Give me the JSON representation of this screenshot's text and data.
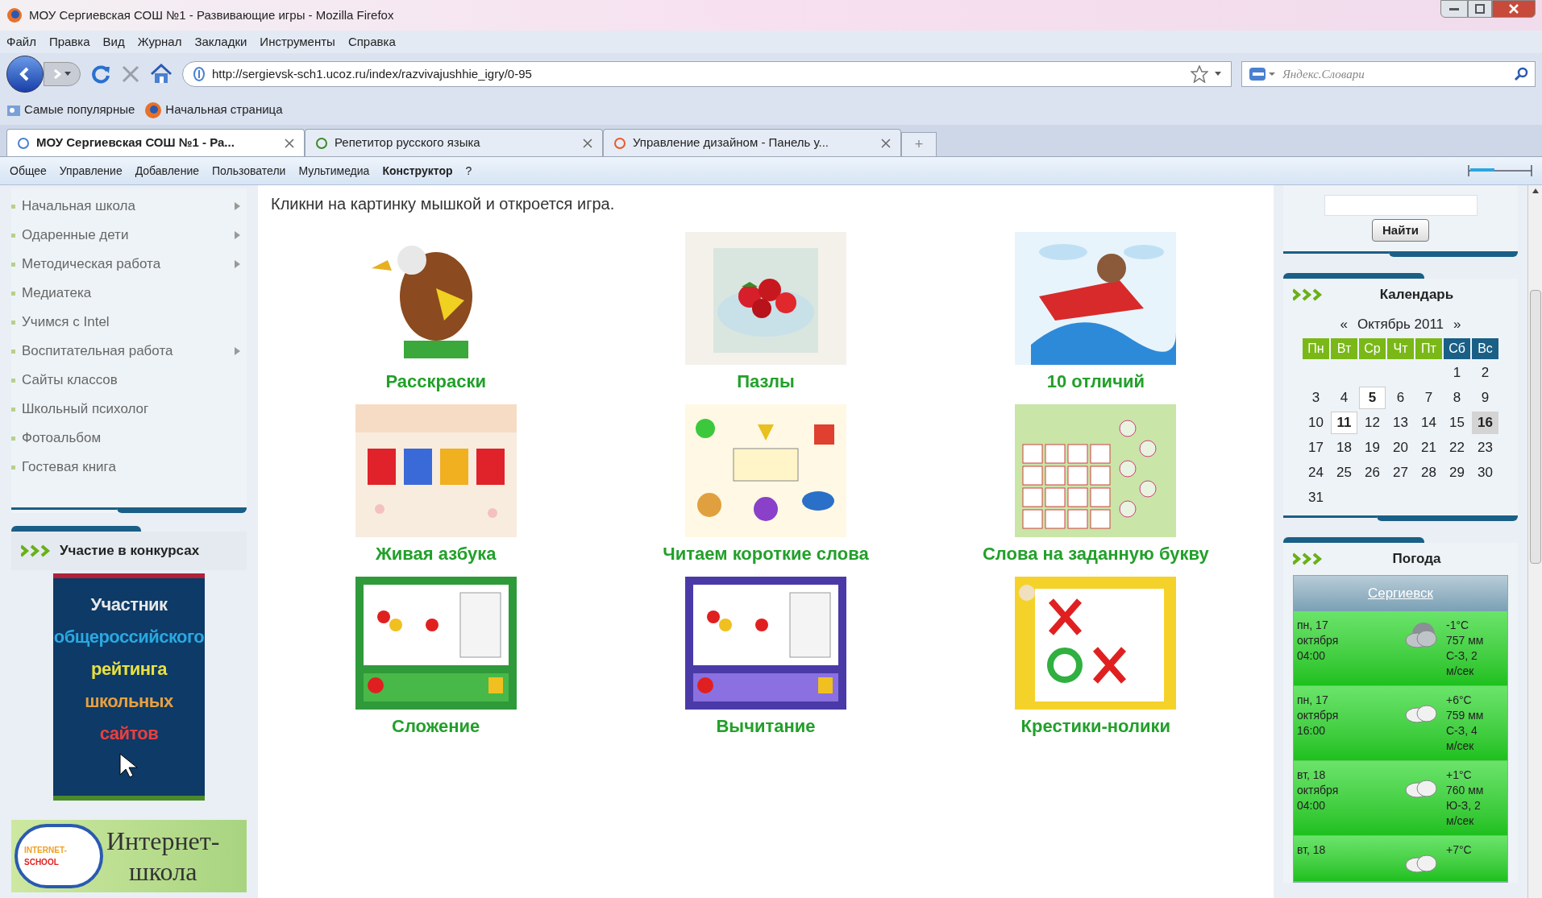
{
  "window": {
    "title": "МОУ Сергиевская СОШ №1 - Развивающие игры - Mozilla Firefox"
  },
  "menu": [
    "Файл",
    "Правка",
    "Вид",
    "Журнал",
    "Закладки",
    "Инструменты",
    "Справка"
  ],
  "address": {
    "value": "http://sergievsk-sch1.ucoz.ru/index/razvivajushhie_igry/0-95"
  },
  "search": {
    "placeholder": "Яндекс.Словари"
  },
  "bookmarks": [
    "Самые популярные",
    "Начальная страница"
  ],
  "tabs": [
    {
      "label": "МОУ Сергиевская СОШ №1 - Ра...",
      "selected": true
    },
    {
      "label": "Репетитор русского языка",
      "selected": false
    },
    {
      "label": "Управление дизайном - Панель у...",
      "selected": false
    }
  ],
  "new_tab": "+",
  "ucoz_panel": [
    {
      "label": "Общее",
      "selected": false
    },
    {
      "label": "Управление",
      "selected": false
    },
    {
      "label": "Добавление",
      "selected": false
    },
    {
      "label": "Пользователи",
      "selected": false
    },
    {
      "label": "Мультимедиа",
      "selected": false
    },
    {
      "label": "Конструктор",
      "selected": true
    },
    {
      "label": "?",
      "selected": false
    }
  ],
  "sidebar": {
    "items": [
      {
        "label": "Начальная школа",
        "has_submenu": true
      },
      {
        "label": "Одаренные дети",
        "has_submenu": true
      },
      {
        "label": "Методическая работа",
        "has_submenu": true
      },
      {
        "label": "Медиатека",
        "has_submenu": false
      },
      {
        "label": "Учимся с Intel",
        "has_submenu": false
      },
      {
        "label": "Воспитательная работа",
        "has_submenu": true
      },
      {
        "label": "Сайты классов",
        "has_submenu": false
      },
      {
        "label": "Школьный психолог",
        "has_submenu": false
      },
      {
        "label": "Фотоальбом",
        "has_submenu": false
      },
      {
        "label": "Гостевая книга",
        "has_submenu": false
      }
    ],
    "contests": {
      "title": "Участие в конкурсах",
      "banner_lines": [
        {
          "text": "Участник",
          "color": "#e8e8e8"
        },
        {
          "text": "общероссийского",
          "color": "#2aa8e0"
        },
        {
          "text": "рейтинга",
          "color": "#e8e040"
        },
        {
          "text": "школьных",
          "color": "#e8a040"
        },
        {
          "text": "сайтов",
          "color": "#e84040"
        }
      ],
      "school_banner": {
        "badge_top": "INTERNET-",
        "badge_bottom": "SCHOOL",
        "lines": [
          "Интернет-",
          "школа"
        ]
      }
    }
  },
  "intro": "Кликни на картинку мышкой и откроется игра.",
  "games": [
    {
      "label": "Расскраски"
    },
    {
      "label": "Пазлы"
    },
    {
      "label": "10 отличий"
    },
    {
      "label": "Живая азбука"
    },
    {
      "label": "Читаем короткие слова"
    },
    {
      "label": "Слова на заданную букву"
    },
    {
      "label": "Сложение"
    },
    {
      "label": "Вычитание"
    },
    {
      "label": "Крестики-нолики"
    }
  ],
  "site_search": {
    "button": "Найти"
  },
  "calendar": {
    "title": "Календарь",
    "prev": "«",
    "month": "Октябрь 2011",
    "next": "»",
    "weekdays": [
      {
        "label": "Пн",
        "weekend": false
      },
      {
        "label": "Вт",
        "weekend": false
      },
      {
        "label": "Ср",
        "weekend": false
      },
      {
        "label": "Чт",
        "weekend": false
      },
      {
        "label": "Пт",
        "weekend": false
      },
      {
        "label": "Сб",
        "weekend": true
      },
      {
        "label": "Вс",
        "weekend": true
      }
    ],
    "weeks": [
      {
        "kind": "leading",
        "days": [
          {
            "day": "1",
            "has_entries": false,
            "selected": false
          },
          {
            "day": "2",
            "has_entries": false,
            "selected": false
          }
        ]
      },
      {
        "kind": "full",
        "days": [
          {
            "day": "3",
            "has_entries": false,
            "selected": false
          },
          {
            "day": "4",
            "has_entries": false,
            "selected": false
          },
          {
            "day": "5",
            "has_entries": true,
            "selected": false
          },
          {
            "day": "6",
            "has_entries": false,
            "selected": false
          },
          {
            "day": "7",
            "has_entries": false,
            "selected": false
          },
          {
            "day": "8",
            "has_entries": false,
            "selected": false
          },
          {
            "day": "9",
            "has_entries": false,
            "selected": false
          }
        ]
      },
      {
        "kind": "full",
        "days": [
          {
            "day": "10",
            "has_entries": false,
            "selected": false
          },
          {
            "day": "11",
            "has_entries": true,
            "selected": false
          },
          {
            "day": "12",
            "has_entries": false,
            "selected": false
          },
          {
            "day": "13",
            "has_entries": false,
            "selected": false
          },
          {
            "day": "14",
            "has_entries": false,
            "selected": false
          },
          {
            "day": "15",
            "has_entries": false,
            "selected": false
          },
          {
            "day": "16",
            "has_entries": false,
            "selected": true
          }
        ]
      },
      {
        "kind": "full",
        "days": [
          {
            "day": "17",
            "has_entries": false,
            "selected": false
          },
          {
            "day": "18",
            "has_entries": false,
            "selected": false
          },
          {
            "day": "19",
            "has_entries": false,
            "selected": false
          },
          {
            "day": "20",
            "has_entries": false,
            "selected": false
          },
          {
            "day": "21",
            "has_entries": false,
            "selected": false
          },
          {
            "day": "22",
            "has_entries": false,
            "selected": false
          },
          {
            "day": "23",
            "has_entries": false,
            "selected": false
          }
        ]
      },
      {
        "kind": "full",
        "days": [
          {
            "day": "24",
            "has_entries": false,
            "selected": false
          },
          {
            "day": "25",
            "has_entries": false,
            "selected": false
          },
          {
            "day": "26",
            "has_entries": false,
            "selected": false
          },
          {
            "day": "27",
            "has_entries": false,
            "selected": false
          },
          {
            "day": "28",
            "has_entries": false,
            "selected": false
          },
          {
            "day": "29",
            "has_entries": false,
            "selected": false
          },
          {
            "day": "30",
            "has_entries": false,
            "selected": false
          }
        ]
      },
      {
        "kind": "trailing",
        "days": [
          {
            "day": "31",
            "has_entries": false,
            "selected": false
          }
        ]
      }
    ]
  },
  "weather": {
    "title": "Погода",
    "city": "Сергиевск",
    "rows": [
      {
        "date": [
          "пн, 17",
          "октября",
          "04:00"
        ],
        "kind": "overcast",
        "reading": [
          "-1°C",
          "757 мм",
          "С-З, 2",
          "м/сек"
        ]
      },
      {
        "date": [
          "пн, 17",
          "октября",
          "16:00"
        ],
        "kind": "cloudy",
        "reading": [
          "+6°C",
          "759 мм",
          "С-З, 4",
          "м/сек"
        ]
      },
      {
        "date": [
          "вт, 18",
          "октября",
          "04:00"
        ],
        "kind": "cloudy",
        "reading": [
          "+1°C",
          "760 мм",
          "Ю-З, 2",
          "м/сек"
        ]
      },
      {
        "date": [
          "вт, 18"
        ],
        "kind": "cloudy",
        "reading": [
          "+7°C"
        ]
      }
    ]
  }
}
